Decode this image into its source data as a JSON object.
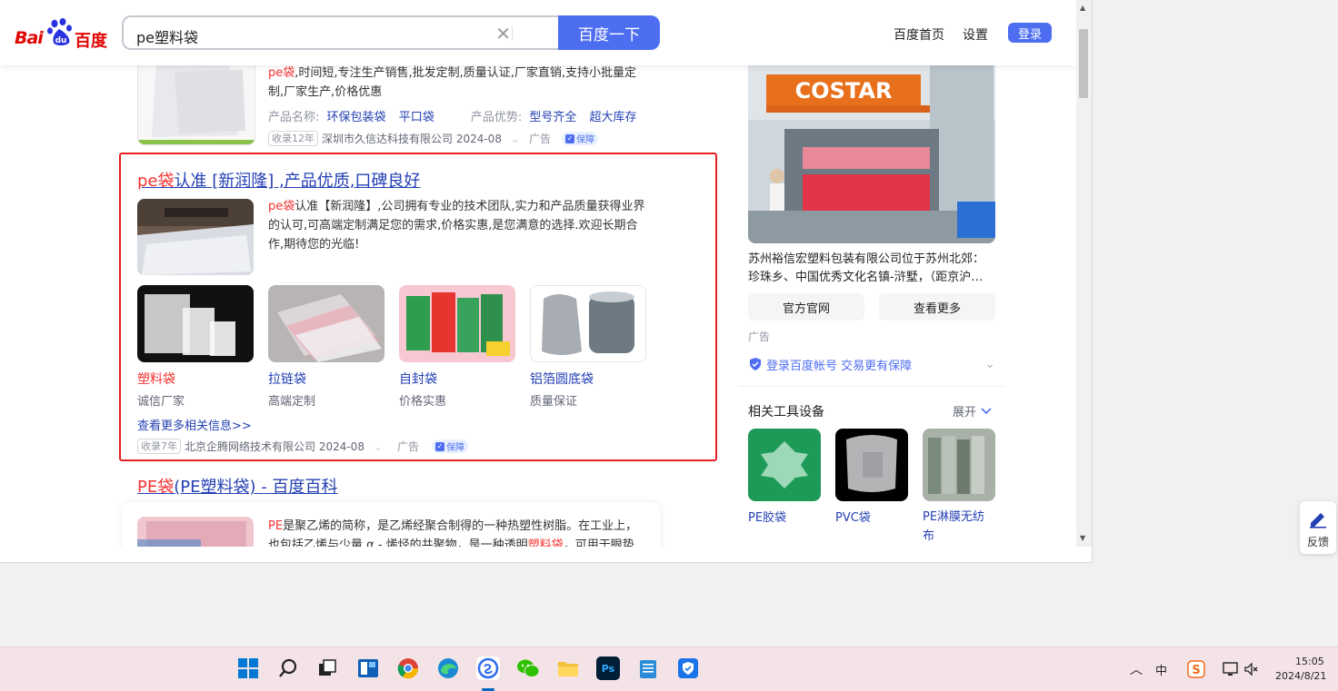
{
  "header": {
    "logo_bai": "Bai",
    "logo_cn": "百度",
    "search_query": "pe塑料袋",
    "search_button": "百度一下",
    "links": [
      "百度首页",
      "设置"
    ],
    "login": "登录"
  },
  "result1": {
    "snippet_red": "pe袋",
    "snippet": ",时间短,专注生产销售,批发定制,质量认证,厂家直销,支持小批量定制,厂家生产,价格优惠",
    "name_label": "产品名称:",
    "name_values": [
      "环保包装袋",
      "平口袋"
    ],
    "adv_label": "产品优势:",
    "adv_values": [
      "型号齐全",
      "超大库存"
    ],
    "tag": "收录12年",
    "company": "深圳市久信达科技有限公司 2024-08",
    "ad": "广告",
    "guarantee": "保障"
  },
  "result2": {
    "title_red": "pe袋",
    "title_rest": "认准 [新润隆] ,产品优质,口碑良好",
    "snippet_red": "pe袋",
    "snippet": "认准【新润隆】,公司拥有专业的技术团队,实力和产品质量获得业界的认可,可高端定制满足您的需求,价格实惠,是您满意的选择.欢迎长期合作,期待您的光临!",
    "cards": [
      {
        "label": "塑料袋",
        "sub": "诚信厂家"
      },
      {
        "label": "拉链袋",
        "sub": "高端定制"
      },
      {
        "label": "自封袋",
        "sub": "价格实惠"
      },
      {
        "label": "铝箔圆底袋",
        "sub": "质量保证"
      }
    ],
    "more": "查看更多相关信息>>",
    "tag": "收录7年",
    "company": "北京企腾网络技术有限公司 2024-08",
    "ad": "广告",
    "guarantee": "保障"
  },
  "result3": {
    "title_red": "PE袋",
    "title_rest": "(PE塑料袋) - 百度百科",
    "snippet_red1": "PE",
    "snippet1": "是聚乙烯的简称，是乙烯经聚合制得的一种热塑性树脂。在工业上，",
    "snippet2a": "也包括乙烯与少量 α - 烯烃的共聚物，是一种透明",
    "snippet_red2": "塑料袋",
    "snippet2b": "，可用于眼垫"
  },
  "right": {
    "banner_text": "COSTAR",
    "desc": "苏州裕信宏塑料包装有限公司位于苏州北郊：珍珠乡、中国优秀文化名镇-浒墅，（距京沪…",
    "buttons": [
      "官方官网",
      "查看更多"
    ],
    "ad": "广告",
    "login_tip": "登录百度帐号 交易更有保障",
    "related_title": "相关工具设备",
    "expand": "展开",
    "related": [
      {
        "label": "PE胶袋"
      },
      {
        "label": "PVC袋"
      },
      {
        "label": "PE淋膜无纺布"
      }
    ]
  },
  "feedback": "反馈",
  "tray": {
    "ime": "中",
    "time": "15:05",
    "date": "2024/8/21"
  },
  "taskbar_icons": [
    "windows-start",
    "search",
    "task-view",
    "widgets",
    "chrome",
    "edge",
    "sogou-browser",
    "wechat",
    "file-explorer",
    "photoshop",
    "notepad",
    "security-center"
  ]
}
